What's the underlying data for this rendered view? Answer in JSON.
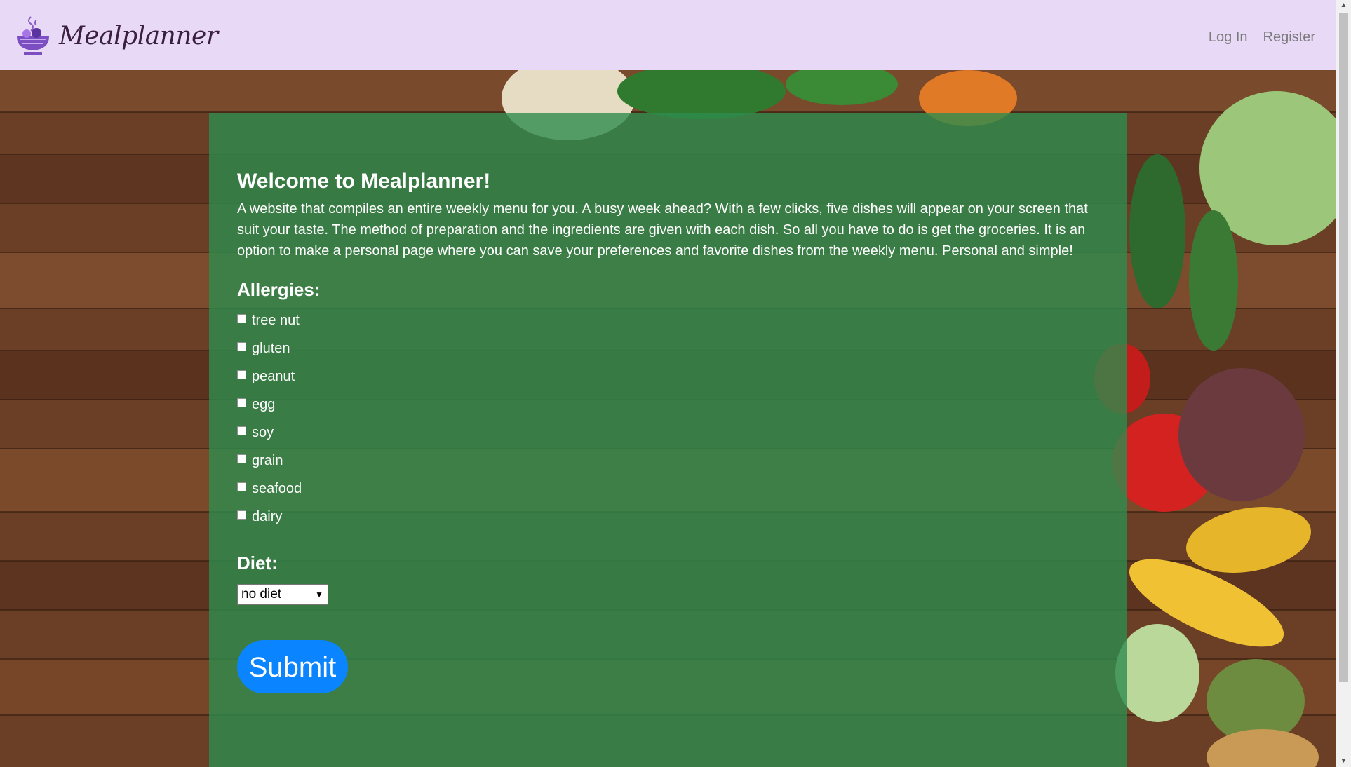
{
  "header": {
    "brand": "Mealplanner",
    "nav": [
      "Log In",
      "Register"
    ]
  },
  "main": {
    "title": "Welcome to Mealplanner!",
    "intro": "A website that compiles an entire weekly menu for you. A busy week ahead? With a few clicks, five dishes will appear on your screen that suit your taste. The method of preparation and the ingredients are given with each dish. So all you have to do is get the groceries. It is an option to make a personal page where you can save your preferences and favorite dishes from the weekly menu. Personal and simple!",
    "allergies_heading": "Allergies:",
    "allergies": [
      "tree nut",
      "gluten",
      "peanut",
      "egg",
      "soy",
      "grain",
      "seafood",
      "dairy"
    ],
    "diet_heading": "Diet:",
    "diet_selected": "no diet",
    "submit_label": "Submit"
  },
  "colors": {
    "navbar": "#e8d9f7",
    "card": "#2e8c4e",
    "submit": "#0a84ff"
  }
}
